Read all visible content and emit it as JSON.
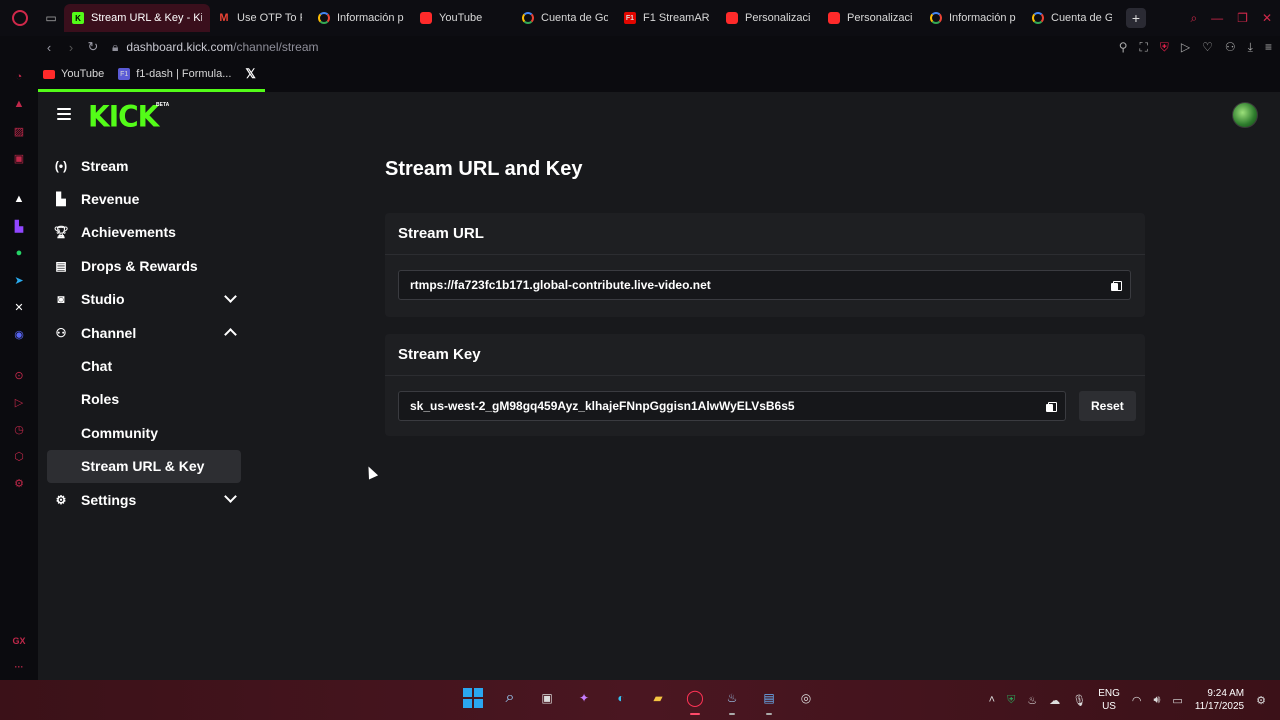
{
  "browser": {
    "tabs": [
      {
        "label": "Stream URL & Key - Kick",
        "icon": "kick",
        "active": true
      },
      {
        "label": "Use OTP To R",
        "icon": "gmail"
      },
      {
        "label": "Información p",
        "icon": "google"
      },
      {
        "label": "YouTube",
        "icon": "youtube"
      },
      {
        "label": "Cuenta de Go",
        "icon": "google"
      },
      {
        "label": "F1 StreamAR",
        "icon": "f1"
      },
      {
        "label": "Personalizaci",
        "icon": "youtube"
      },
      {
        "label": "Personalizaci",
        "icon": "youtube"
      },
      {
        "label": "Información p",
        "icon": "google"
      },
      {
        "label": "Cuenta de Go",
        "icon": "google"
      }
    ],
    "url_host": "dashboard.kick.com",
    "url_path": "/channel/stream",
    "bookmarks": [
      {
        "label": "YouTube",
        "icon": "youtube"
      },
      {
        "label": "f1-dash | Formula...",
        "icon": "f1"
      },
      {
        "label": "",
        "icon": "x"
      }
    ],
    "accent": "#d0284a"
  },
  "kick": {
    "logo": "KICK",
    "beta": "BETA",
    "brand_color": "#53fc18",
    "nav": [
      {
        "label": "Stream",
        "icon": "broadcast-icon"
      },
      {
        "label": "Revenue",
        "icon": "chart-icon"
      },
      {
        "label": "Achievements",
        "icon": "trophy-icon"
      },
      {
        "label": "Drops & Rewards",
        "icon": "gift-icon"
      },
      {
        "label": "Studio",
        "icon": "camera-icon",
        "chevron": "down"
      },
      {
        "label": "Channel",
        "icon": "users-icon",
        "chevron": "up"
      },
      {
        "label": "Chat",
        "sub": true
      },
      {
        "label": "Roles",
        "sub": true
      },
      {
        "label": "Community",
        "sub": true
      },
      {
        "label": "Stream URL & Key",
        "sub": true,
        "active": true
      },
      {
        "label": "Settings",
        "icon": "gear-icon",
        "chevron": "down"
      }
    ],
    "page_title": "Stream URL and Key",
    "stream_url": {
      "heading": "Stream URL",
      "value": "rtmps://fa723fc1b171.global-contribute.live-video.net"
    },
    "stream_key": {
      "heading": "Stream Key",
      "value": "sk_us-west-2_gM98gq459Ayz_klhajeFNnpGggisn1AlwWyELVsB6s5",
      "reset_label": "Reset"
    }
  },
  "taskbar": {
    "lang": "ENG",
    "region": "US",
    "time": "9:24 AM",
    "date": "11/17/2025"
  }
}
